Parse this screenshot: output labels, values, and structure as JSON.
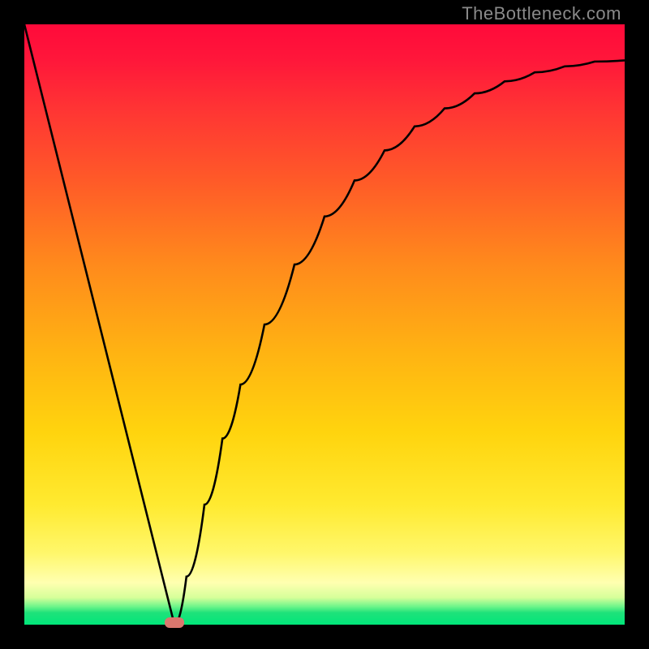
{
  "watermark": "TheBottleneck.com",
  "chart_data": {
    "type": "line",
    "title": "",
    "xlabel": "",
    "ylabel": "",
    "xlim": [
      0,
      1
    ],
    "ylim": [
      0,
      1
    ],
    "series": [
      {
        "name": "bottleneck-curve",
        "x": [
          0.0,
          0.05,
          0.1,
          0.15,
          0.2,
          0.23,
          0.25,
          0.27,
          0.3,
          0.33,
          0.36,
          0.4,
          0.45,
          0.5,
          0.55,
          0.6,
          0.65,
          0.7,
          0.75,
          0.8,
          0.85,
          0.9,
          0.95,
          1.0
        ],
        "values": [
          1.0,
          0.8,
          0.6,
          0.4,
          0.2,
          0.08,
          0.0,
          0.08,
          0.2,
          0.31,
          0.4,
          0.5,
          0.6,
          0.68,
          0.74,
          0.79,
          0.83,
          0.86,
          0.885,
          0.905,
          0.92,
          0.93,
          0.938,
          0.94
        ]
      }
    ],
    "annotations": [
      {
        "name": "minimum-marker",
        "x": 0.25,
        "y": 0.0,
        "shape": "rounded-rect",
        "color": "#d9776e"
      }
    ],
    "background_gradient": {
      "direction": "vertical",
      "stops": [
        {
          "pos": 0.0,
          "color": "#ff0a3a"
        },
        {
          "pos": 0.4,
          "color": "#ff8a1c"
        },
        {
          "pos": 0.8,
          "color": "#ffea30"
        },
        {
          "pos": 0.95,
          "color": "#d6ff9a"
        },
        {
          "pos": 1.0,
          "color": "#00e67a"
        }
      ]
    }
  }
}
